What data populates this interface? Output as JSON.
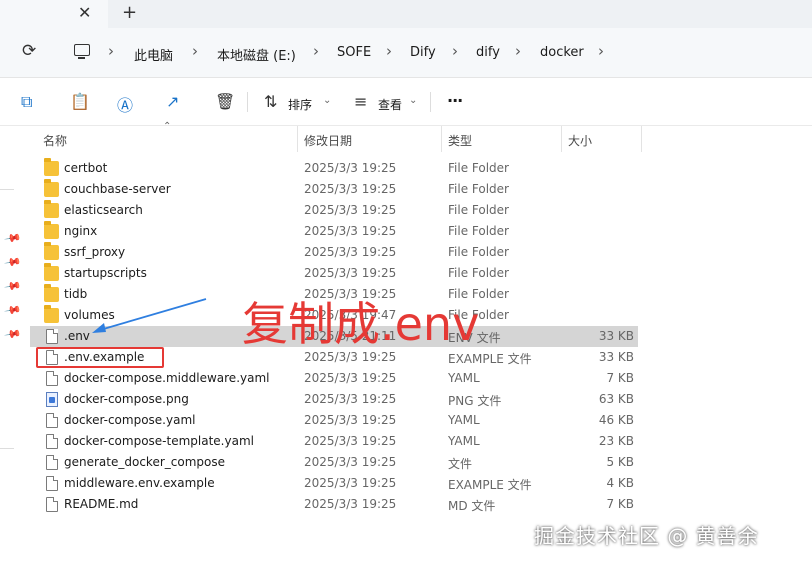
{
  "tabs": {
    "close_symbol": "✕",
    "new_tab_symbol": "+"
  },
  "breadcrumb": {
    "items": [
      "此电脑",
      "本地磁盘 (E:)",
      "SOFE",
      "Dify",
      "dify",
      "docker"
    ],
    "separator": "›"
  },
  "toolbar": {
    "sort_label": "排序",
    "view_label": "查看",
    "more_symbol": "···"
  },
  "columns": {
    "name": "名称",
    "modified": "修改日期",
    "type": "类型",
    "size": "大小"
  },
  "files": [
    {
      "name": "certbot",
      "date": "2025/3/3 19:25",
      "type": "File Folder",
      "size": "",
      "icon": "folder"
    },
    {
      "name": "couchbase-server",
      "date": "2025/3/3 19:25",
      "type": "File Folder",
      "size": "",
      "icon": "folder"
    },
    {
      "name": "elasticsearch",
      "date": "2025/3/3 19:25",
      "type": "File Folder",
      "size": "",
      "icon": "folder"
    },
    {
      "name": "nginx",
      "date": "2025/3/3 19:25",
      "type": "File Folder",
      "size": "",
      "icon": "folder"
    },
    {
      "name": "ssrf_proxy",
      "date": "2025/3/3 19:25",
      "type": "File Folder",
      "size": "",
      "icon": "folder"
    },
    {
      "name": "startupscripts",
      "date": "2025/3/3 19:25",
      "type": "File Folder",
      "size": "",
      "icon": "folder"
    },
    {
      "name": "tidb",
      "date": "2025/3/3 19:25",
      "type": "File Folder",
      "size": "",
      "icon": "folder"
    },
    {
      "name": "volumes",
      "date": "2025/3/3 19:47",
      "type": "File Folder",
      "size": "",
      "icon": "folder"
    },
    {
      "name": ".env",
      "date": "2025/3/5 21:11",
      "type": "ENV 文件",
      "size": "33 KB",
      "icon": "file",
      "selected": true
    },
    {
      "name": ".env.example",
      "date": "2025/3/3 19:25",
      "type": "EXAMPLE 文件",
      "size": "33 KB",
      "icon": "file"
    },
    {
      "name": "docker-compose.middleware.yaml",
      "date": "2025/3/3 19:25",
      "type": "YAML",
      "size": "7 KB",
      "icon": "file"
    },
    {
      "name": "docker-compose.png",
      "date": "2025/3/3 19:25",
      "type": "PNG 文件",
      "size": "63 KB",
      "icon": "png"
    },
    {
      "name": "docker-compose.yaml",
      "date": "2025/3/3 19:25",
      "type": "YAML",
      "size": "46 KB",
      "icon": "file"
    },
    {
      "name": "docker-compose-template.yaml",
      "date": "2025/3/3 19:25",
      "type": "YAML",
      "size": "23 KB",
      "icon": "file"
    },
    {
      "name": "generate_docker_compose",
      "date": "2025/3/3 19:25",
      "type": "文件",
      "size": "5 KB",
      "icon": "file"
    },
    {
      "name": "middleware.env.example",
      "date": "2025/3/3 19:25",
      "type": "EXAMPLE 文件",
      "size": "4 KB",
      "icon": "file"
    },
    {
      "name": "README.md",
      "date": "2025/3/3 19:25",
      "type": "MD 文件",
      "size": "7 KB",
      "icon": "file"
    }
  ],
  "annotation": {
    "text": "复制成.env",
    "color": "#e53935"
  },
  "watermark": "掘金技术社区 @ 黄善余"
}
